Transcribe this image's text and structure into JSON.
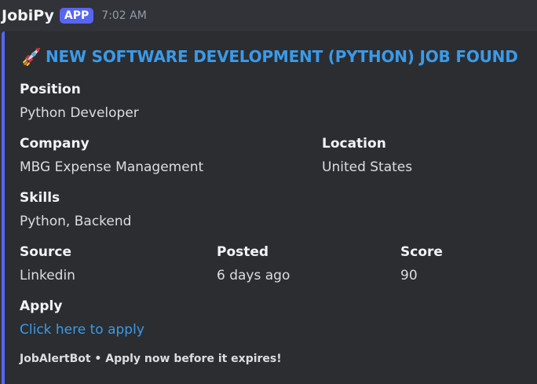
{
  "author": {
    "username": "JobiPy",
    "badge": "APP",
    "timestamp": "7:02 AM"
  },
  "embed": {
    "accent_color": "#5865f2",
    "title_icon": "rocket-icon",
    "title": "NEW SOFTWARE DEVELOPMENT (PYTHON) JOB FOUND",
    "fields": {
      "position": {
        "name": "Position",
        "value": "Python Developer"
      },
      "company": {
        "name": "Company",
        "value": "MBG Expense Management"
      },
      "location": {
        "name": "Location",
        "value": "United States"
      },
      "skills": {
        "name": "Skills",
        "value": "Python, Backend"
      },
      "source": {
        "name": "Source",
        "value": "Linkedin"
      },
      "posted": {
        "name": "Posted",
        "value": "6 days ago"
      },
      "score": {
        "name": "Score",
        "value": "90"
      },
      "apply": {
        "name": "Apply",
        "value": "Click here to apply"
      }
    },
    "footer": "JobAlertBot • Apply now before it expires!"
  }
}
